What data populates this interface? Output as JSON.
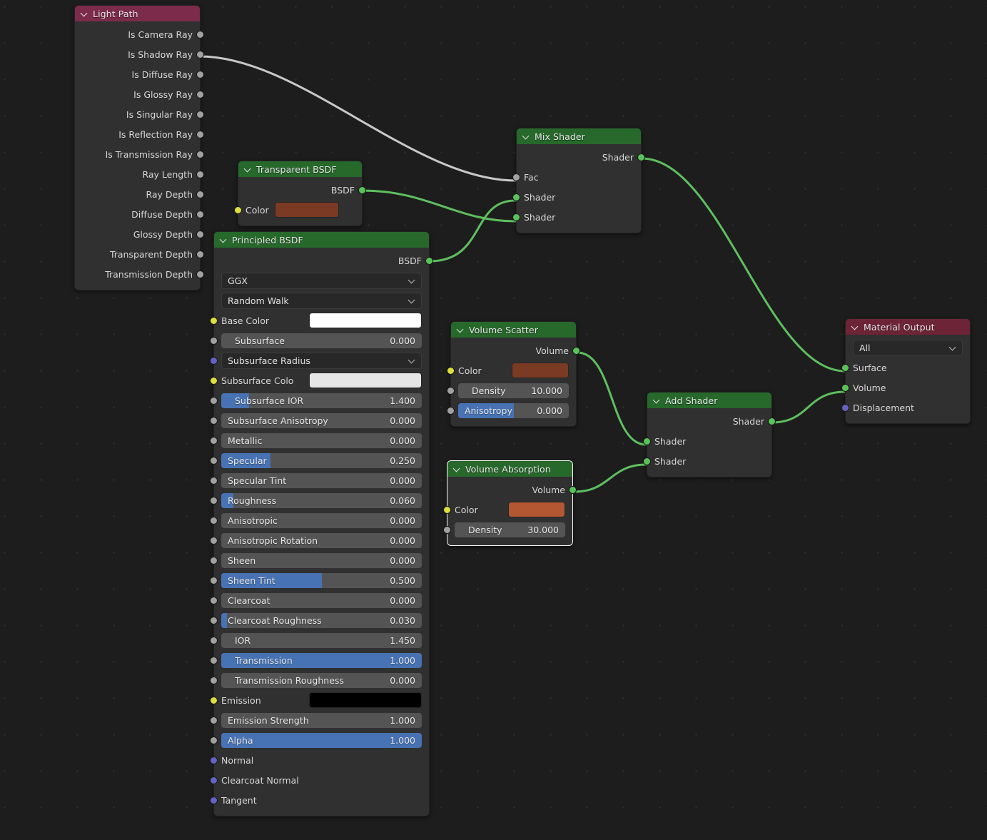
{
  "editor": {
    "background": "#1d1d1d",
    "grid_dot_color": "#2a2a2a"
  },
  "colors": {
    "header_shader": "#27682b",
    "header_input": "#7c2b4a",
    "header_output": "#6d2437",
    "node_body": "#303030",
    "slider_fill": "#4772b3",
    "socket_shader": "#59c359",
    "socket_value": "#a1a1a1",
    "socket_color": "#dede3c",
    "socket_vector": "#6363c7",
    "link_shader": "#5fbf5f",
    "link_value": "#c8c8c8"
  },
  "nodes": {
    "light_path": {
      "title": "Light Path",
      "outputs": [
        "Is Camera Ray",
        "Is Shadow Ray",
        "Is Diffuse Ray",
        "Is Glossy Ray",
        "Is Singular Ray",
        "Is Reflection Ray",
        "Is Transmission Ray",
        "Ray Length",
        "Ray Depth",
        "Diffuse Depth",
        "Glossy Depth",
        "Transparent Depth",
        "Transmission Depth"
      ]
    },
    "transparent_bsdf": {
      "title": "Transparent BSDF",
      "output_label": "BSDF",
      "color_label": "Color",
      "color_value": "#7a3a24"
    },
    "principled_bsdf": {
      "title": "Principled BSDF",
      "output_label": "BSDF",
      "distribution": "GGX",
      "subsurface_method": "Random Walk",
      "base_color_label": "Base Color",
      "base_color_value": "#ffffff",
      "subsurface_radius_label": "Subsurface Radius",
      "subsurface_color_label": "Subsurface Colo",
      "subsurface_color_value": "#e5e5e5",
      "emission_label": "Emission",
      "emission_value": "#000000",
      "sliders": [
        {
          "name": "Subsurface",
          "value": "0.000",
          "fill": 0.0,
          "indent": true
        },
        {
          "name": "Subsurface IOR",
          "value": "1.400",
          "fill": 0.14,
          "indent": true
        },
        {
          "name": "Subsurface Anisotropy",
          "value": "0.000",
          "fill": 0.0,
          "indent": false
        },
        {
          "name": "Metallic",
          "value": "0.000",
          "fill": 0.0,
          "indent": false
        },
        {
          "name": "Specular",
          "value": "0.250",
          "fill": 0.245,
          "indent": false
        },
        {
          "name": "Specular Tint",
          "value": "0.000",
          "fill": 0.0,
          "indent": false
        },
        {
          "name": "Roughness",
          "value": "0.060",
          "fill": 0.06,
          "indent": false
        },
        {
          "name": "Anisotropic",
          "value": "0.000",
          "fill": 0.0,
          "indent": false
        },
        {
          "name": "Anisotropic Rotation",
          "value": "0.000",
          "fill": 0.0,
          "indent": false
        },
        {
          "name": "Sheen",
          "value": "0.000",
          "fill": 0.0,
          "indent": false
        },
        {
          "name": "Sheen Tint",
          "value": "0.500",
          "fill": 0.5,
          "indent": false
        },
        {
          "name": "Clearcoat",
          "value": "0.000",
          "fill": 0.0,
          "indent": false
        },
        {
          "name": "Clearcoat Roughness",
          "value": "0.030",
          "fill": 0.03,
          "indent": false
        },
        {
          "name": "IOR",
          "value": "1.450",
          "fill": 0.0,
          "indent": true
        },
        {
          "name": "Transmission",
          "value": "1.000",
          "fill": 1.0,
          "indent": true
        },
        {
          "name": "Transmission Roughness",
          "value": "0.000",
          "fill": 0.0,
          "indent": true
        }
      ],
      "emission_strength": {
        "name": "Emission Strength",
        "value": "1.000",
        "fill": 0.0
      },
      "alpha": {
        "name": "Alpha",
        "value": "1.000",
        "fill": 1.0
      },
      "vector_inputs": [
        "Normal",
        "Clearcoat Normal",
        "Tangent"
      ]
    },
    "mix_shader": {
      "title": "Mix Shader",
      "output_label": "Shader",
      "inputs": [
        "Fac",
        "Shader",
        "Shader"
      ]
    },
    "volume_scatter": {
      "title": "Volume Scatter",
      "output_label": "Volume",
      "color_label": "Color",
      "color_value": "#7a3a24",
      "density": {
        "name": "Density",
        "value": "10.000",
        "fill": 0.0
      },
      "anisotropy": {
        "name": "Anisotropy",
        "value": "0.000",
        "fill": 0.5
      }
    },
    "volume_absorption": {
      "title": "Volume Absorption",
      "output_label": "Volume",
      "color_label": "Color",
      "color_value": "#b35732",
      "density": {
        "name": "Density",
        "value": "30.000",
        "fill": 0.0
      },
      "selected": true
    },
    "add_shader": {
      "title": "Add Shader",
      "output_label": "Shader",
      "inputs": [
        "Shader",
        "Shader"
      ]
    },
    "material_output": {
      "title": "Material Output",
      "target": "All",
      "inputs": [
        "Surface",
        "Volume",
        "Displacement"
      ]
    }
  }
}
